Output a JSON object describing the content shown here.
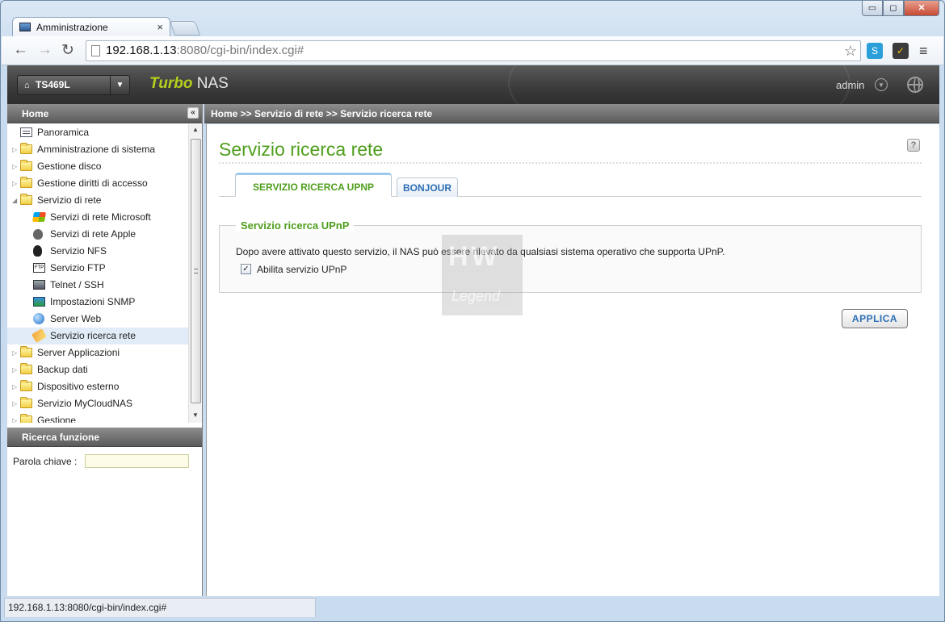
{
  "browser": {
    "tab_title": "Amministrazione",
    "tab_close": "×",
    "url_host": "192.168.1.13",
    "url_rest": ":8080/cgi-bin/index.cgi#",
    "status_text": "192.168.1.13:8080/cgi-bin/index.cgi#",
    "window_buttons": {
      "minimize": "▭",
      "maximize": "◻",
      "close": "✕"
    }
  },
  "header": {
    "model": "TS469L",
    "brand_turbo": "Turbo",
    "brand_nas": " NAS",
    "user": "admin"
  },
  "sidebar": {
    "title": "Home",
    "items": [
      {
        "label": "Panoramica",
        "icon": "document-icon"
      },
      {
        "label": "Amministrazione di sistema",
        "icon": "folder-icon"
      },
      {
        "label": "Gestione disco",
        "icon": "folder-icon"
      },
      {
        "label": "Gestione diritti di accesso",
        "icon": "folder-icon"
      },
      {
        "label": "Servizio di rete",
        "icon": "folder-open-icon"
      },
      {
        "label": "Servizi di rete Microsoft",
        "icon": "windows-icon"
      },
      {
        "label": "Servizi di rete Apple",
        "icon": "apple-icon"
      },
      {
        "label": "Servizio NFS",
        "icon": "linux-icon"
      },
      {
        "label": "Servizio FTP",
        "icon": "ftp-icon"
      },
      {
        "label": "Telnet / SSH",
        "icon": "terminal-icon"
      },
      {
        "label": "Impostazioni SNMP",
        "icon": "network-icon"
      },
      {
        "label": "Server Web",
        "icon": "globe-icon"
      },
      {
        "label": "Servizio ricerca rete",
        "icon": "discovery-icon"
      },
      {
        "label": "Server Applicazioni",
        "icon": "folder-icon"
      },
      {
        "label": "Backup dati",
        "icon": "folder-icon"
      },
      {
        "label": "Dispositivo esterno",
        "icon": "folder-icon"
      },
      {
        "label": "Servizio MyCloudNAS",
        "icon": "folder-icon"
      },
      {
        "label": "Gestione",
        "icon": "folder-icon"
      }
    ],
    "search_title": "Ricerca funzione",
    "keyword_label": "Parola chiave :",
    "keyword_value": ""
  },
  "breadcrumb": "Home >> Servizio di rete >> Servizio ricerca rete",
  "main": {
    "title": "Servizio ricerca rete",
    "help": "?",
    "tabs": [
      {
        "label": "SERVIZIO RICERCA UPNP"
      },
      {
        "label": "BONJOUR"
      }
    ],
    "section_title": "Servizio ricerca UPnP",
    "description": "Dopo avere attivato questo servizio, il NAS può essere rilevato da qualsiasi sistema operativo che supporta UPnP.",
    "checkbox_label": "Abilita servizio UPnP",
    "checkbox_checked": true,
    "apply_label": "APPLICA",
    "watermark_hw": "HW",
    "watermark_legend": "Legend"
  },
  "colors": {
    "accent_green": "#4f9e1c",
    "link_blue": "#2d6fb6",
    "header_dark": "#3a3a3a"
  }
}
